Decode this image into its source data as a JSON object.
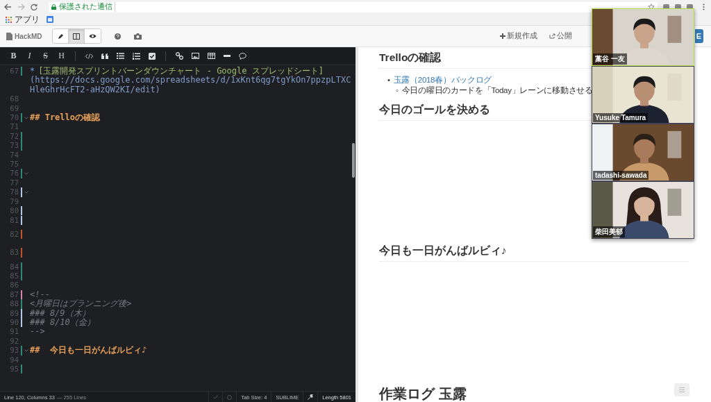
{
  "browser": {
    "security_label": "保護された通信"
  },
  "bookmarks": {
    "apps_label": "アプリ"
  },
  "navbar": {
    "brand": "HackMD",
    "modes": [
      {
        "selected": false
      },
      {
        "selected": true
      },
      {
        "selected": false
      }
    ],
    "new_label": "新規作成",
    "publish_label": "公開",
    "share_label": "E"
  },
  "editor": {
    "format_letters": [
      "B",
      "I",
      "S",
      "H"
    ],
    "lines": [
      {
        "number": "67",
        "kind": "link",
        "bullet": "*",
        "label": "[玉露開発スプリントバーンダウンチャート - Google スプレッドシート]",
        "url": "(https://docs.google.com/spreadsheets/d/1xKnt6qg7tgYkOn7ppzpLTXCHleGhrHcFT2-aHzQW2KI/edit)",
        "color": "#2e8b73",
        "foldable": false
      },
      {
        "number": "68",
        "kind": "blank",
        "foldable": false
      },
      {
        "number": "69",
        "kind": "blank",
        "foldable": false
      },
      {
        "number": "70",
        "kind": "heading",
        "text": "## Trelloの確認",
        "color": "#2e8b73",
        "foldable": true
      },
      {
        "number": "71",
        "kind": "blank",
        "foldable": false
      },
      {
        "number": "72",
        "kind": "blank",
        "color": "#2e8b73",
        "foldable": false
      },
      {
        "number": "73",
        "kind": "blank",
        "color": "#2e8b73",
        "foldable": false
      },
      {
        "number": "74",
        "kind": "blank",
        "foldable": false
      },
      {
        "number": "75",
        "kind": "blank",
        "foldable": false
      },
      {
        "number": "76",
        "kind": "blank",
        "color": "#2e8b73",
        "foldable": true
      },
      {
        "number": "77",
        "kind": "blank",
        "foldable": false
      },
      {
        "number": "78",
        "kind": "blank",
        "color": "#b5c8e6",
        "foldable": true
      },
      {
        "number": "79",
        "kind": "blank",
        "foldable": false
      },
      {
        "number": "80",
        "kind": "blank",
        "color": "#b5c8e6",
        "foldable": false
      },
      {
        "number": "81",
        "kind": "blank",
        "color": "#b5c8e6",
        "foldable": false
      },
      {
        "number": "82",
        "kind": "spacer",
        "color": "#c2532b",
        "foldable": false
      },
      {
        "number": "83",
        "kind": "spacer",
        "color": "#c2532b",
        "foldable": false
      },
      {
        "number": "84",
        "kind": "blank",
        "color": "#2e8b73",
        "foldable": false
      },
      {
        "number": "85",
        "kind": "blank",
        "color": "#2e8b73",
        "foldable": false
      },
      {
        "number": "86",
        "kind": "blank",
        "foldable": false
      },
      {
        "number": "87",
        "kind": "comment",
        "text": "<!--",
        "color": "#d887a8",
        "foldable": false
      },
      {
        "number": "88",
        "kind": "comment",
        "text": "<月曜日はプランニング後>",
        "color": "#2e8b73",
        "foldable": false
      },
      {
        "number": "89",
        "kind": "comment",
        "text": "### 8/9（木）",
        "color": "#b5c8e6",
        "foldable": false
      },
      {
        "number": "90",
        "kind": "comment",
        "text": "### 8/10（金）",
        "color": "#b5c8e6",
        "foldable": false
      },
      {
        "number": "91",
        "kind": "comment",
        "text": "-->",
        "foldable": false
      },
      {
        "number": "92",
        "kind": "blank",
        "foldable": false
      },
      {
        "number": "93",
        "kind": "heading",
        "text": "##  今日も一日がんばルビィ♪",
        "color": "#2e8b73",
        "foldable": true
      },
      {
        "number": "94",
        "kind": "blank",
        "foldable": false
      },
      {
        "number": "95",
        "kind": "blank",
        "color": "#2e8b73",
        "foldable": false
      }
    ],
    "status": {
      "position": "Line 120, Columns 33",
      "line_count": "— 255 Lines",
      "tab_size": "Tab Size: 4",
      "keymap": "SUBLIME",
      "length": "Length 5801"
    }
  },
  "preview": {
    "blocks": [
      {
        "kind": "h2",
        "text": "Trelloの確認"
      },
      {
        "kind": "list",
        "items": [
          {
            "marker": "•",
            "text": "玉露（2018春）バックログ",
            "link": true,
            "children": [
              {
                "marker": "◦",
                "text": "今日の曜日のカードを「Today」レーンに移動させる",
                "link": false
              }
            ]
          }
        ]
      },
      {
        "kind": "h2",
        "text": "今日のゴールを決める"
      },
      {
        "kind": "space"
      },
      {
        "kind": "h2",
        "text": "今日も一日がんばルビィ♪"
      },
      {
        "kind": "space"
      },
      {
        "kind": "h1",
        "text": "作業ログ 玉露"
      }
    ]
  },
  "video_call": {
    "participants": [
      {
        "name": "藁谷 一友",
        "speaking": true
      },
      {
        "name": "Yusuke Tamura",
        "speaking": false
      },
      {
        "name": "tadashi-sawada",
        "speaking": false
      },
      {
        "name": "柴田美郁",
        "speaking": false
      }
    ]
  }
}
